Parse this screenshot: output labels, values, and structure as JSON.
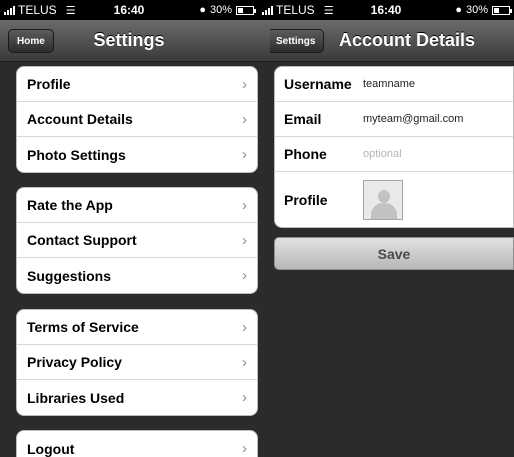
{
  "status": {
    "carrier": "TELUS",
    "time": "16:40",
    "battery": "30%"
  },
  "settings_screen": {
    "nav_button": "Home",
    "title": "Settings",
    "groups": [
      [
        "Profile",
        "Account Details",
        "Photo Settings"
      ],
      [
        "Rate the App",
        "Contact Support",
        "Suggestions"
      ],
      [
        "Terms of Service",
        "Privacy Policy",
        "Libraries Used"
      ],
      [
        "Logout"
      ]
    ]
  },
  "account_screen": {
    "back_button": "Settings",
    "title": "Account Details",
    "fields": {
      "username_label": "Username",
      "username_value": "teamname",
      "email_label": "Email",
      "email_value": "myteam@gmail.com",
      "phone_label": "Phone",
      "phone_placeholder": "optional",
      "profile_label": "Profile"
    },
    "save_label": "Save"
  },
  "colors": {
    "background": "#2b2b2b",
    "navbar": "#4a4a4a"
  }
}
